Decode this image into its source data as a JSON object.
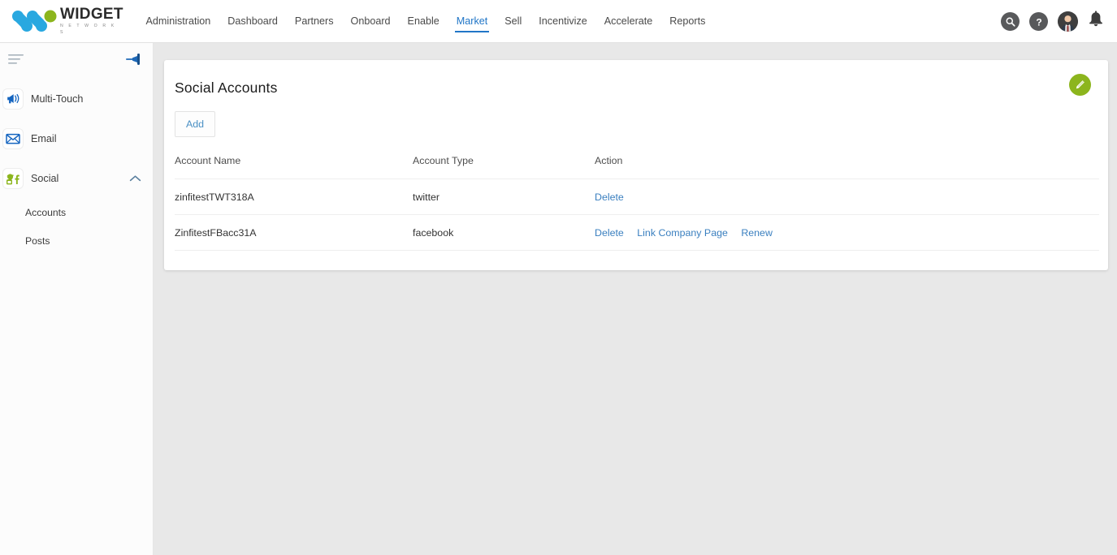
{
  "brand": {
    "name": "WIDGET",
    "tagline": "N E T W O R K S",
    "logo_blue": "#29a8e0",
    "logo_green": "#8cb51d"
  },
  "header": {
    "nav": [
      {
        "label": "Administration",
        "active": false
      },
      {
        "label": "Dashboard",
        "active": false
      },
      {
        "label": "Partners",
        "active": false
      },
      {
        "label": "Onboard",
        "active": false
      },
      {
        "label": "Enable",
        "active": false
      },
      {
        "label": "Market",
        "active": true
      },
      {
        "label": "Sell",
        "active": false
      },
      {
        "label": "Incentivize",
        "active": false
      },
      {
        "label": "Accelerate",
        "active": false
      },
      {
        "label": "Reports",
        "active": false
      }
    ],
    "actions": [
      {
        "icon": "search-icon",
        "label": "Search"
      },
      {
        "icon": "help-icon",
        "label": "Help"
      },
      {
        "icon": "avatar",
        "label": "User Profile"
      },
      {
        "icon": "bell-icon",
        "label": "Notifications"
      }
    ],
    "accent_color": "#2176c7"
  },
  "sidebar": {
    "menu_icon": "hamburger-icon",
    "pin_icon": "pin-icon",
    "items": [
      {
        "label": "Multi-Touch",
        "icon": "megaphone-icon",
        "expandable": false,
        "expanded": false
      },
      {
        "label": "Email",
        "icon": "envelope-icon",
        "expandable": false,
        "expanded": false
      },
      {
        "label": "Social",
        "icon": "social-icon",
        "expandable": true,
        "expanded": true
      }
    ],
    "sub_items": [
      {
        "label": "Accounts",
        "parent": "Social"
      },
      {
        "label": "Posts",
        "parent": "Social"
      }
    ]
  },
  "card": {
    "title": "Social Accounts",
    "edit_icon": "pencil-icon",
    "edit_color": "#8cb51d",
    "add_label": "Add",
    "table": {
      "columns": [
        "Account Name",
        "Account Type",
        "Action"
      ],
      "rows": [
        {
          "name": "zinfitestTWT318A",
          "type": "twitter",
          "actions": [
            "Delete"
          ]
        },
        {
          "name": "ZinfitestFBacc31A",
          "type": "facebook",
          "actions": [
            "Delete",
            "Link Company Page",
            "Renew"
          ]
        }
      ]
    },
    "link_color": "#3a7fbf"
  }
}
